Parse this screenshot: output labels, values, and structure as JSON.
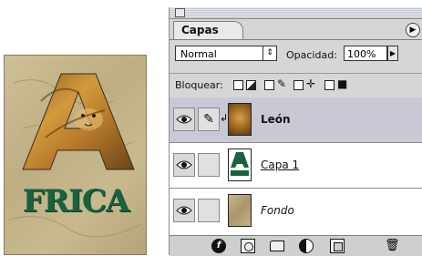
{
  "poster": {
    "big_letter": "A",
    "rest_of_word": "FRICA"
  },
  "panel": {
    "tab_label": "Capas",
    "menu_icon": "arrow-right-icon",
    "blend_mode": "Normal",
    "opacity_label": "Opacidad:",
    "opacity_value": "100%",
    "lock_label": "Bloquear:",
    "layers": [
      {
        "name": "León",
        "selected": true,
        "visible": true,
        "thumb": "lion"
      },
      {
        "name": "Capa 1",
        "selected": false,
        "visible": true,
        "thumb": "africa-text"
      },
      {
        "name": "Fondo",
        "selected": false,
        "visible": true,
        "thumb": "parchment"
      }
    ],
    "bottom_icons": [
      "layer-style-icon",
      "mask-icon",
      "folder-icon",
      "adjustment-icon",
      "new-layer-icon",
      "trash-icon"
    ]
  }
}
